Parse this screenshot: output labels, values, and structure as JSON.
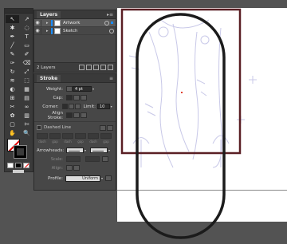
{
  "layers_panel": {
    "tab_label": "Layers",
    "menu_glyph": "▸≡",
    "layers": [
      {
        "name": "Artwork",
        "color": "#1a8cff",
        "selected": true
      },
      {
        "name": "Sketch",
        "color": "#1a8cff",
        "selected": false
      }
    ],
    "layer_count": "2 Layers"
  },
  "stroke_panel": {
    "tab_label": "Stroke",
    "weight_label": "Weight:",
    "weight_value": "4 pt",
    "cap_label": "Cap:",
    "corner_label": "Corner:",
    "limit_label": "Limit:",
    "limit_value": "10",
    "align_label": "Align Stroke:",
    "dashed_label": "Dashed Line",
    "dash_labels": [
      "dash",
      "gap",
      "dash",
      "gap",
      "dash",
      "gap"
    ],
    "arrowheads_label": "Arrowheads:",
    "scale_label": "Scale:",
    "align_arrow_label": "Align:",
    "profile_label": "Profile:",
    "profile_value": "Uniform"
  },
  "toolbar": {
    "tools": [
      "selection-tool",
      "direct-selection-tool",
      "magic-wand-tool",
      "lasso-tool",
      "pen-tool",
      "type-tool",
      "line-tool",
      "rectangle-tool",
      "paintbrush-tool",
      "pencil-tool",
      "blob-brush-tool",
      "eraser-tool",
      "rotate-tool",
      "scale-tool",
      "width-tool",
      "free-transform-tool",
      "shape-builder-tool",
      "perspective-grid-tool",
      "mesh-tool",
      "gradient-tool",
      "eyedropper-tool",
      "blend-tool",
      "symbol-sprayer-tool",
      "column-graph-tool",
      "artboard-tool",
      "slice-tool",
      "hand-tool",
      "zoom-tool"
    ]
  },
  "colors": {
    "artboard_border": "#5a1f24",
    "shape_stroke": "#1b1b1b",
    "sketch_lines": "#c8c8e8",
    "center_point": "#e04030"
  }
}
